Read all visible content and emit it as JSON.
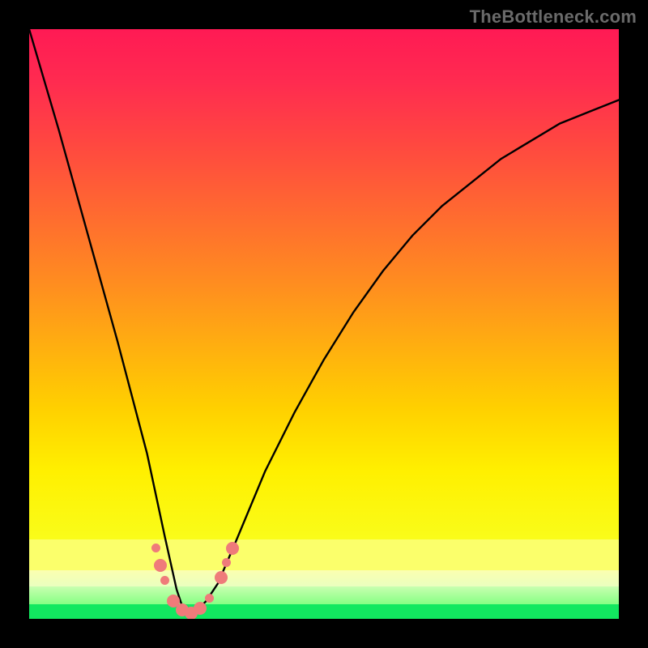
{
  "watermark": "TheBottleneck.com",
  "colors": {
    "frame": "#000000",
    "bead": "#ef7b7a",
    "curve": "#000000",
    "green_bar": "#12e860"
  },
  "chart_data": {
    "type": "line",
    "title": "",
    "xlabel": "",
    "ylabel": "",
    "xlim": [
      0,
      100
    ],
    "ylim": [
      0,
      100
    ],
    "grid": false,
    "legend": false,
    "note": "Bottleneck-style V-curve. y ≈ 0 at the optimum (~x=27), rises steeply on both sides. Values estimated from pixel positions; no axis ticks or labels are rendered in the image.",
    "series": [
      {
        "name": "bottleneck_curve",
        "x": [
          0,
          5,
          10,
          15,
          20,
          23,
          25,
          26,
          27,
          28,
          29,
          30,
          32,
          35,
          40,
          45,
          50,
          55,
          60,
          65,
          70,
          75,
          80,
          85,
          90,
          95,
          100
        ],
        "y": [
          100,
          83,
          65,
          47,
          28,
          14,
          5,
          2,
          1,
          1,
          2,
          3,
          6,
          13,
          25,
          35,
          44,
          52,
          59,
          65,
          70,
          74,
          78,
          81,
          84,
          86,
          88
        ]
      }
    ],
    "markers": [
      {
        "x": 21.5,
        "y": 12.0,
        "size": "small"
      },
      {
        "x": 22.2,
        "y": 9.0,
        "size": "large"
      },
      {
        "x": 23.0,
        "y": 6.5,
        "size": "small"
      },
      {
        "x": 24.5,
        "y": 3.0,
        "size": "large"
      },
      {
        "x": 26.0,
        "y": 1.5,
        "size": "large"
      },
      {
        "x": 27.5,
        "y": 1.0,
        "size": "large"
      },
      {
        "x": 29.0,
        "y": 1.8,
        "size": "large"
      },
      {
        "x": 30.5,
        "y": 3.5,
        "size": "small"
      },
      {
        "x": 32.5,
        "y": 7.0,
        "size": "large"
      },
      {
        "x": 33.5,
        "y": 9.5,
        "size": "small"
      },
      {
        "x": 34.5,
        "y": 12.0,
        "size": "large"
      }
    ],
    "background_gradient": {
      "top": "#ff1a54",
      "mid": "#ffd000",
      "lower": "#fbff6b",
      "bottom": "#12e860"
    }
  }
}
